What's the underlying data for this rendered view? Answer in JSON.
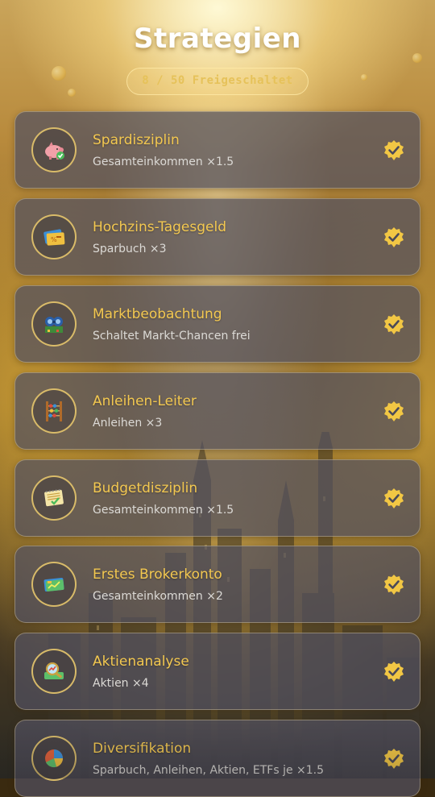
{
  "header": {
    "title": "Strategien",
    "progress": "8 / 50 Freigeschaltet"
  },
  "colors": {
    "title_gold": "#f3c850",
    "check_gold": "#f2c744",
    "card_bg": "#52505f"
  },
  "strategies": [
    {
      "title": "Spardisziplin",
      "effect": "Gesamteinkommen ×1.5",
      "icon": "piggy-bank-icon",
      "unlocked": true
    },
    {
      "title": "Hochzins-Tagesgeld",
      "effect": "Sparbuch ×3",
      "icon": "savings-book-icon",
      "unlocked": true
    },
    {
      "title": "Marktbeobachtung",
      "effect": "Schaltet Markt-Chancen frei",
      "icon": "market-stall-icon",
      "unlocked": true
    },
    {
      "title": "Anleihen-Leiter",
      "effect": "Anleihen ×3",
      "icon": "abacus-ladder-icon",
      "unlocked": true
    },
    {
      "title": "Budgetdisziplin",
      "effect": "Gesamteinkommen ×1.5",
      "icon": "budget-notebook-icon",
      "unlocked": true
    },
    {
      "title": "Erstes Brokerkonto",
      "effect": "Gesamteinkommen ×2",
      "icon": "broker-card-icon",
      "unlocked": true
    },
    {
      "title": "Aktienanalyse",
      "effect": "Aktien ×4",
      "icon": "magnifier-chart-icon",
      "unlocked": true
    },
    {
      "title": "Diversifikation",
      "effect": "Sparbuch, Anleihen, Aktien, ETFs je ×1.5",
      "icon": "pie-chart-icon",
      "unlocked": true
    }
  ]
}
